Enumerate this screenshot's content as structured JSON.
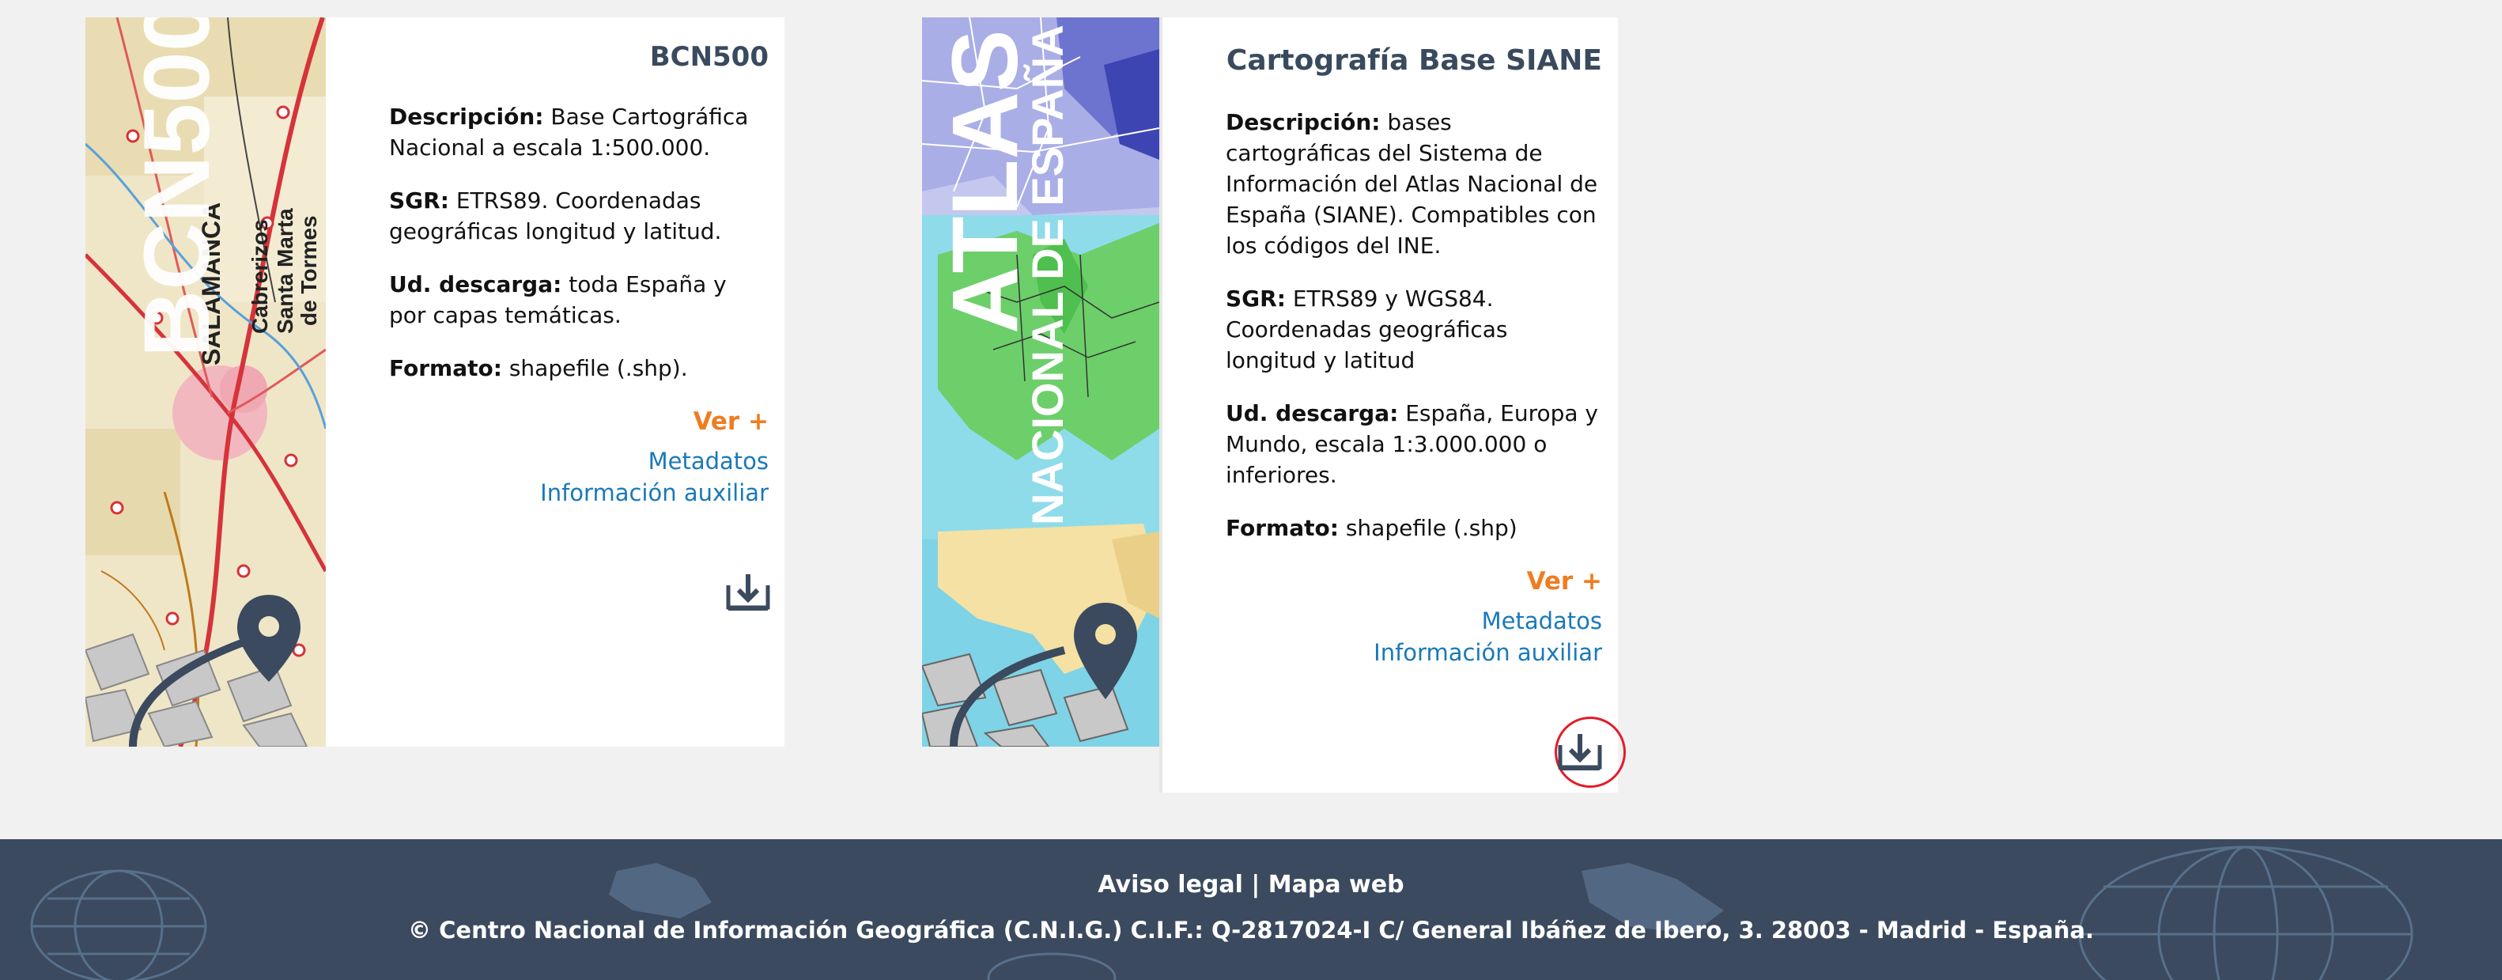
{
  "cards": [
    {
      "title": "BCN500",
      "thumb_text": "BCN500",
      "map_labels": [
        "SALAMANCA",
        "Cabrerizos",
        "Santa Marta",
        "de Tormes"
      ],
      "description_label": "Descripción:",
      "description": "Base Cartográfica Nacional a escala 1:500.000.",
      "sgr_label": "SGR:",
      "sgr": "ETRS89. Coordenadas geográficas longitud y latitud.",
      "download_label": "Ud. descarga:",
      "download": "toda España y por capas temáticas.",
      "format_label": "Formato:",
      "format": "shapefile (.shp).",
      "more": "Ver +",
      "metadata": "Metadatos",
      "aux": "Información auxiliar"
    },
    {
      "title": "Cartografía Base SIANE",
      "thumb_text_1": "ATLAS",
      "thumb_text_2": "NACIONAL DE ESPAÑA",
      "description_label": "Descripción:",
      "description": "bases cartográficas del Sistema de Información del Atlas Nacional de España (SIANE). Compatibles con los códigos del INE.",
      "sgr_label": "SGR:",
      "sgr": "ETRS89 y WGS84. Coordenadas geográficas longitud y latitud",
      "download_label": "Ud. descarga:",
      "download": "España, Europa y Mundo, escala 1:3.000.000 o inferiores.",
      "format_label": "Formato:",
      "format": "shapefile (.shp)",
      "more": "Ver +",
      "metadata": "Metadatos",
      "aux": "Información auxiliar"
    }
  ],
  "footer": {
    "legal": "Aviso legal",
    "separator": "|",
    "sitemap": "Mapa web",
    "copyright": "© Centro Nacional de Información Geográfica (C.N.I.G.) C.I.F.: Q-2817024-I C/ General Ibáñez de Ibero, 3. 28003 - Madrid - España."
  },
  "colors": {
    "accent_orange": "#ee7d22",
    "link_blue": "#1a79b8",
    "footer_bg": "#3b4a5e",
    "title_slate": "#3a4a5e",
    "annotation_red": "#e21d2a"
  },
  "icons": [
    "download-icon",
    "map-pin-icon"
  ]
}
